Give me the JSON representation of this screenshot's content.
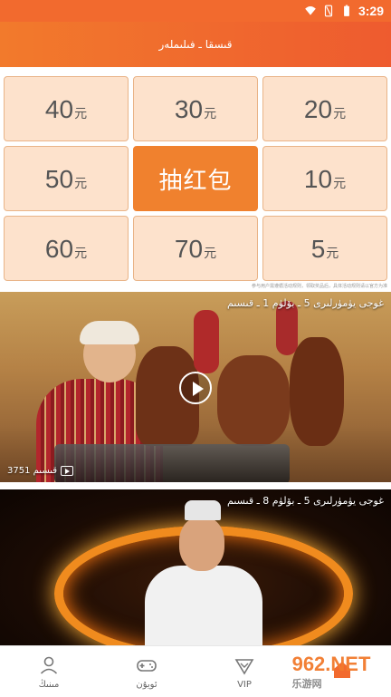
{
  "status_bar": {
    "time": "3:29"
  },
  "header": {
    "title": "قىسقا ـ فىلىملەر"
  },
  "amount_grid": [
    {
      "value": "40",
      "unit": "元"
    },
    {
      "value": "30",
      "unit": "元"
    },
    {
      "value": "20",
      "unit": "元"
    },
    {
      "value": "50",
      "unit": "元"
    },
    {
      "value": "抽红包",
      "unit": ""
    },
    {
      "value": "10",
      "unit": "元"
    },
    {
      "value": "60",
      "unit": "元"
    },
    {
      "value": "70",
      "unit": "元"
    },
    {
      "value": "5",
      "unit": "元"
    }
  ],
  "notice_text": "参与用户需遵循活动规则，领取奖品后，具体活动规则请以官方为准",
  "videos": [
    {
      "title": "غوجى يۈمۈرلىرى 5 ـ بۆلۈم 1 ـ قىسىم",
      "count": "3751 قىسىم"
    },
    {
      "title": "غوجى يۈمۈرلىرى 5 ـ بۆلۈم 8 ـ قىسىم"
    }
  ],
  "tabbar": [
    {
      "label": "مىنىڭ",
      "icon": "person-icon"
    },
    {
      "label": "ئويۇن",
      "icon": "gamepad-icon"
    },
    {
      "label": "VIP",
      "icon": "diamond-icon"
    },
    {
      "label": "",
      "icon": "home-icon"
    }
  ],
  "watermark": {
    "text": "962.NET",
    "sub": "乐游网"
  },
  "colors": {
    "accent": "#f26a2e",
    "cell_bg": "#fde2cc",
    "center_cell": "#f0812e"
  }
}
